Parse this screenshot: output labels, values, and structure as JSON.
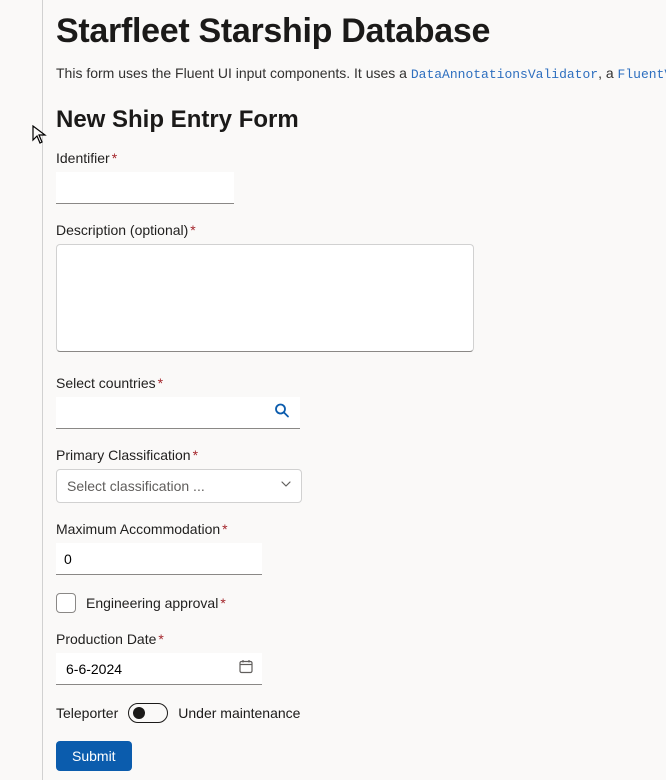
{
  "page": {
    "title": "Starfleet Starship Database",
    "intro_prefix": "This form uses the Fluent UI input components. It uses a ",
    "code1": "DataAnnotationsValidator",
    "intro_mid": ", a ",
    "code2": "FluentValida",
    "heading": "New Ship Entry Form"
  },
  "fields": {
    "identifier": {
      "label": "Identifier",
      "value": ""
    },
    "description": {
      "label": "Description (optional)",
      "value": ""
    },
    "countries": {
      "label": "Select countries",
      "value": ""
    },
    "classification": {
      "label": "Primary Classification",
      "placeholder": "Select classification ..."
    },
    "accommodation": {
      "label": "Maximum Accommodation",
      "value": "0"
    },
    "approval": {
      "label": "Engineering approval"
    },
    "production": {
      "label": "Production Date",
      "value": "6-6-2024"
    },
    "teleporter": {
      "label": "Teleporter",
      "state": "Under maintenance"
    }
  },
  "buttons": {
    "submit": "Submit"
  }
}
